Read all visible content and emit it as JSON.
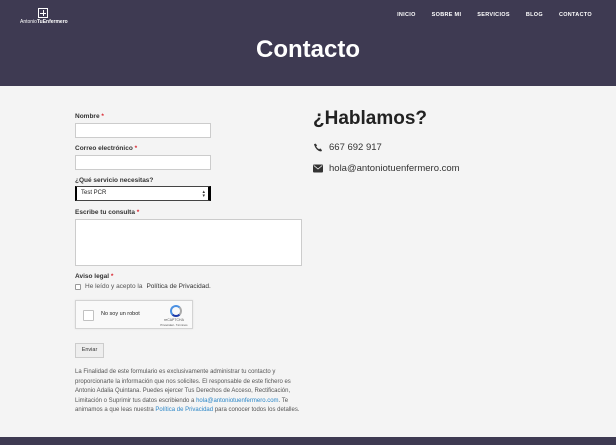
{
  "brand": {
    "logo_plain": "Antonio",
    "logo_bold": "TuEnfermero"
  },
  "nav": {
    "items": [
      "INICIO",
      "SOBRE MI",
      "SERVICIOS",
      "BLOG",
      "CONTACTO"
    ]
  },
  "page_title": "Contacto",
  "form": {
    "name_label": "Nombre",
    "email_label": "Correo electrónico",
    "service_label": "¿Qué servicio necesitas?",
    "service_value": "Test PCR",
    "message_label": "Escribe tu consulta",
    "legal_label": "Aviso legal",
    "required_mark": "*",
    "checkbox_text": "He leído y acepto la",
    "checkbox_link": "Política de Privacidad.",
    "recaptcha_text": "No soy un robot",
    "recaptcha_brand": "reCAPTCHA",
    "recaptcha_links": "Privacidad - Términos",
    "submit_label": "Enviar"
  },
  "legal_text": {
    "part1": "La Finalidad de este formulario es exclusivamente administrar tu contacto y proporcionarte la información que nos solicites. El responsable de este fichero es Antonio Adalia Quintana. Puedes ejercer Tus Derechos de Acceso, Rectificación, Limitación o Suprimir tus datos escribiendo a",
    "email_link": "hola@antoniotuenfermero.com",
    "part2": ". Te animamos a que leas nuestra",
    "policy_link": "Política de Privacidad",
    "part3": "para conocer todos los detalles."
  },
  "contact": {
    "heading": "¿Hablamos?",
    "phone": "667 692 917",
    "email": "hola@antoniotuenfermero.com"
  },
  "colors": {
    "header_bg": "#3e3a52",
    "required": "#d9232d",
    "link": "#2a86c7"
  }
}
